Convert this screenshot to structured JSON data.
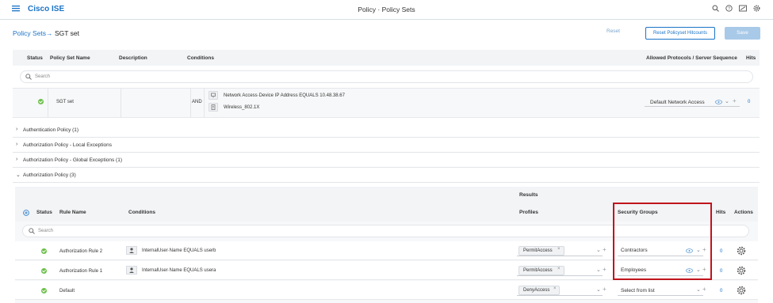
{
  "app": {
    "title": "Cisco ISE",
    "page_title": "Policy · Policy Sets",
    "menu_icon": "hamburger-menu-icon",
    "top_icons": [
      "search-icon",
      "help-icon",
      "notifications-icon",
      "settings-gear-icon"
    ]
  },
  "breadcrumb": {
    "link": "Policy Sets→",
    "current": "SGT set"
  },
  "actions": {
    "reset": "Reset",
    "reset_hitcounts": "Reset Policyset Hitcounts",
    "save": "Save"
  },
  "policy_set_table": {
    "headers": {
      "status": "Status",
      "name": "Policy Set Name",
      "description": "Description",
      "conditions": "Conditions",
      "allowed_protocols": "Allowed Protocols / Server Sequence",
      "hits": "Hits"
    },
    "search_placeholder": "Search",
    "row": {
      "name": "SGT set",
      "operator": "AND",
      "conditions": [
        "Network Access·Device IP Address  EQUALS  10.48.38.67",
        "Wireless_802.1X"
      ],
      "allowed_protocols": "Default Network Access",
      "hits": "0"
    }
  },
  "sections": [
    "Authentication Policy (1)",
    "Authorization Policy - Local Exceptions",
    "Authorization Policy - Global Exceptions (1)",
    "Authorization Policy (3)"
  ],
  "authz_table": {
    "headers": {
      "results": "Results",
      "status": "Status",
      "rule_name": "Rule Name",
      "conditions": "Conditions",
      "profiles": "Profiles",
      "security_groups": "Security Groups",
      "hits": "Hits",
      "actions": "Actions"
    },
    "search_placeholder": "Search",
    "rows": [
      {
        "name": "Authorization Rule 2",
        "condition": "InternalUser·Name  EQUALS  userb",
        "profile": "PermitAccess",
        "security_group": "Contractors",
        "hits": "0"
      },
      {
        "name": "Authorization Rule 1",
        "condition": "InternalUser·Name  EQUALS  usera",
        "profile": "PermitAccess",
        "security_group": "Employees",
        "hits": "0"
      },
      {
        "name": "Default",
        "condition": "",
        "profile": "DenyAccess",
        "security_group": "Select from list",
        "hits": "0"
      }
    ]
  },
  "colors": {
    "brand": "#1a73c7",
    "status_green": "#6cc04a",
    "highlight": "#c0141c"
  }
}
